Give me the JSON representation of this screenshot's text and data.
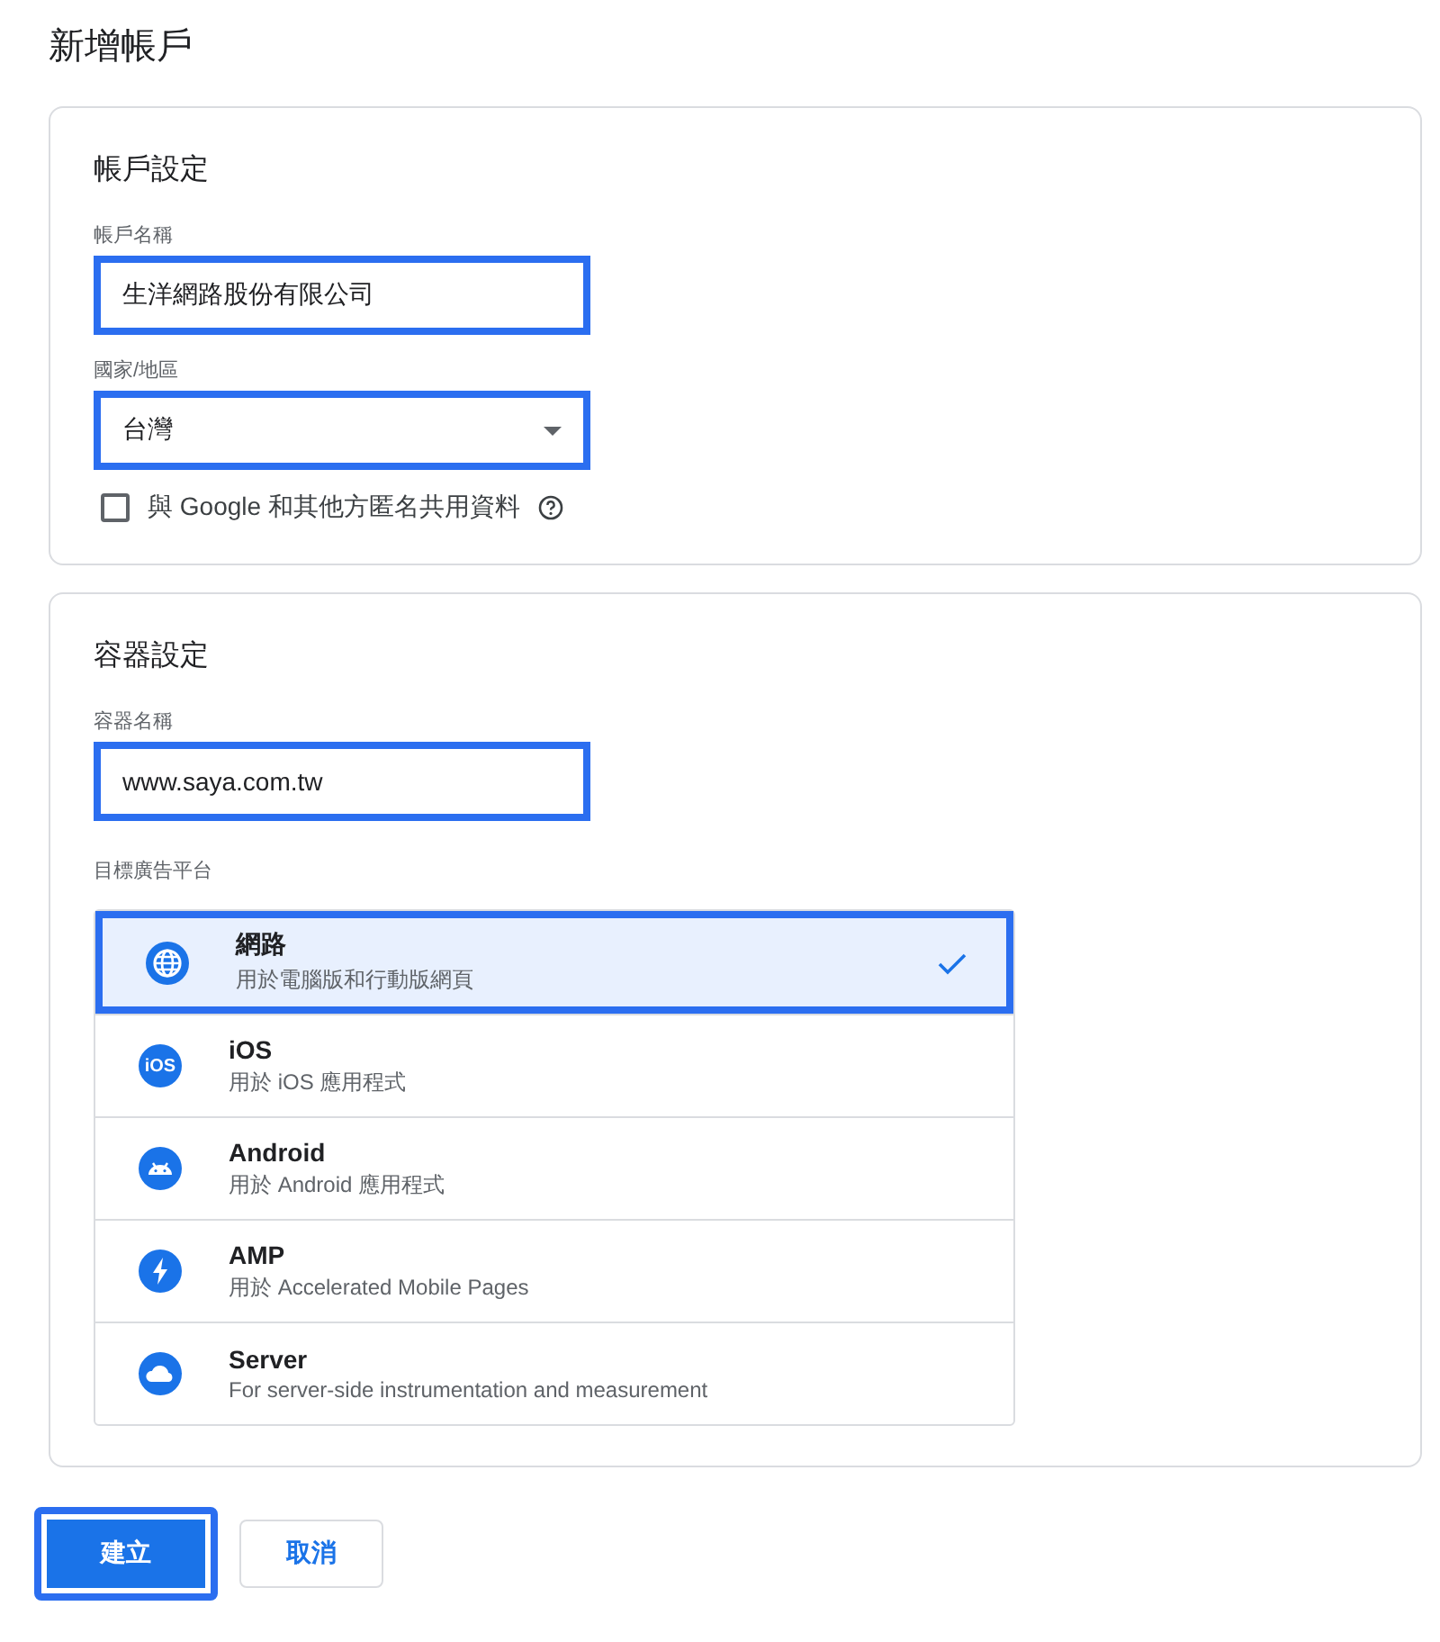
{
  "page_title": "新增帳戶",
  "account_settings": {
    "heading": "帳戶設定",
    "account_name": {
      "label": "帳戶名稱",
      "value": "生洋網路股份有限公司",
      "highlighted": true
    },
    "country": {
      "label": "國家/地區",
      "value": "台灣",
      "highlighted": true
    },
    "share_data": {
      "label": "與 Google 和其他方匿名共用資料",
      "checked": false
    }
  },
  "container_settings": {
    "heading": "容器設定",
    "container_name": {
      "label": "容器名稱",
      "value": "www.saya.com.tw",
      "highlighted": true
    },
    "platform_label": "目標廣告平台",
    "platforms": [
      {
        "kind": "web",
        "title": "網路",
        "subtitle": "用於電腦版和行動版網頁",
        "selected": true,
        "highlighted": true
      },
      {
        "kind": "ios",
        "badge": "iOS",
        "title": "iOS",
        "subtitle": "用於 iOS 應用程式",
        "selected": false,
        "highlighted": false
      },
      {
        "kind": "android",
        "title": "Android",
        "subtitle": "用於 Android 應用程式",
        "selected": false,
        "highlighted": false
      },
      {
        "kind": "amp",
        "title": "AMP",
        "subtitle": "用於 Accelerated Mobile Pages",
        "selected": false,
        "highlighted": false
      },
      {
        "kind": "server",
        "title": "Server",
        "subtitle": "For server-side instrumentation and measurement",
        "selected": false,
        "highlighted": false
      }
    ]
  },
  "buttons": [
    {
      "kind": "primary",
      "label": "建立",
      "highlighted": true
    },
    {
      "kind": "secondary",
      "label": "取消",
      "highlighted": false
    }
  ]
}
